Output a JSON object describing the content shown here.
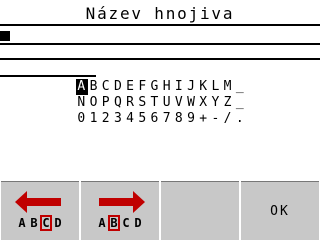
{
  "title": "Název hnojiva",
  "input": {
    "value": ""
  },
  "charset": {
    "rows": [
      [
        "A",
        "B",
        "C",
        "D",
        "E",
        "F",
        "G",
        "H",
        "I",
        "J",
        "K",
        "L",
        "M",
        "_"
      ],
      [
        "N",
        "O",
        "P",
        "Q",
        "R",
        "S",
        "T",
        "U",
        "V",
        "W",
        "X",
        "Y",
        "Z",
        "_"
      ],
      [
        "0",
        "1",
        "2",
        "3",
        "4",
        "5",
        "6",
        "7",
        "8",
        "9",
        "+",
        "-",
        "/",
        "."
      ]
    ],
    "selected": "A"
  },
  "softkeys": {
    "left": {
      "icon": "arrow-left-icon",
      "letters": [
        "A",
        "B",
        "C",
        "D"
      ]
    },
    "right": {
      "icon": "arrow-right-icon",
      "letters": [
        "A",
        "B",
        "C",
        "D"
      ]
    },
    "empty": {
      "label": ""
    },
    "ok": {
      "label": "OK"
    }
  },
  "colors": {
    "accent": "#c00000",
    "softkey_bg": "#c8c8c8"
  }
}
